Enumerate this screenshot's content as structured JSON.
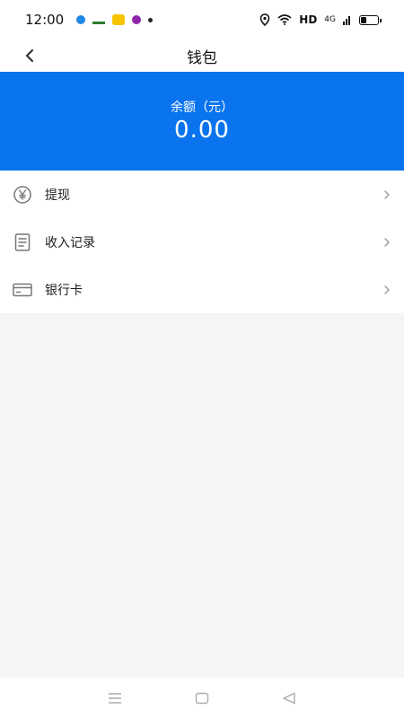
{
  "status_bar": {
    "time": "12:00",
    "network": "HD",
    "signal": "4G",
    "battery_level": 0.35
  },
  "header": {
    "title": "钱包"
  },
  "balance": {
    "label": "余额（元）",
    "amount": "0.00"
  },
  "menu": {
    "items": [
      {
        "label": "提现",
        "icon": "yuan-coin-icon"
      },
      {
        "label": "收入记录",
        "icon": "document-icon"
      },
      {
        "label": "银行卡",
        "icon": "bank-card-icon"
      }
    ]
  },
  "colors": {
    "accent": "#0a74ee",
    "background": "#f5f5f5"
  }
}
